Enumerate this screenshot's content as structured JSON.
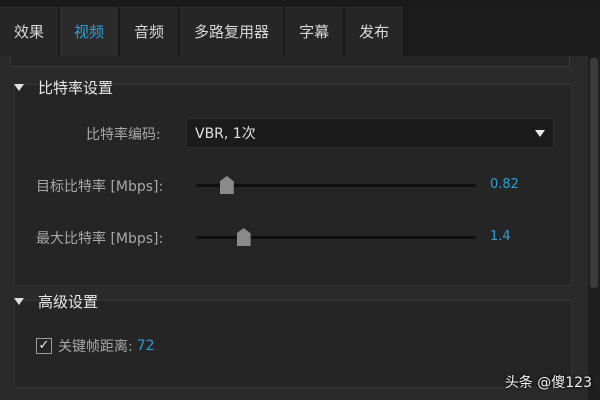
{
  "tabs": [
    {
      "label": "效果",
      "active": false
    },
    {
      "label": "视频",
      "active": true
    },
    {
      "label": "音频",
      "active": false
    },
    {
      "label": "多路复用器",
      "active": false
    },
    {
      "label": "字幕",
      "active": false
    },
    {
      "label": "发布",
      "active": false
    }
  ],
  "bitrate_section": {
    "title": "比特率设置",
    "encoding_label": "比特率编码:",
    "encoding_value": "VBR, 1次",
    "target_label": "目标比特率 [Mbps]:",
    "target_value": "0.82",
    "target_fraction": 0.06,
    "max_label": "最大比特率 [Mbps]:",
    "max_value": "1.4",
    "max_fraction": 0.12
  },
  "advanced_section": {
    "title": "高级设置",
    "keyframe_label": "关键帧距离:",
    "keyframe_value": "72",
    "keyframe_checked": true,
    "check_glyph": "✓"
  },
  "watermark": "头条 @傻123",
  "colors": {
    "accent": "#2a9fd6"
  }
}
